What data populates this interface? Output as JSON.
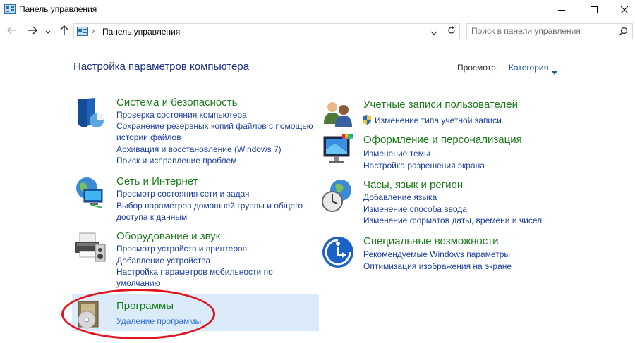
{
  "window": {
    "title": "Панель управления"
  },
  "address": {
    "path": "Панель управления",
    "separator": "›"
  },
  "search": {
    "placeholder": "Поиск в панели управления"
  },
  "header": {
    "heading": "Настройка параметров компьютера",
    "view_label": "Просмотр:",
    "view_value": "Категория"
  },
  "categories": {
    "system": {
      "title": "Система и безопасность",
      "links": [
        "Проверка состояния компьютера",
        "Сохранение резервных копий файлов с помощью",
        "истории файлов",
        "Архивация и восстановление (Windows 7)",
        "Поиск и исправление проблем"
      ]
    },
    "network": {
      "title": "Сеть и Интернет",
      "links": [
        "Просмотр состояния сети и задач",
        "Выбор параметров домашней группы и общего",
        "доступа к данным"
      ]
    },
    "hardware": {
      "title": "Оборудование и звук",
      "links": [
        "Просмотр устройств и принтеров",
        "Добавление устройства",
        "Настройка параметров мобильности по",
        "умолчанию"
      ]
    },
    "programs": {
      "title": "Программы",
      "links": [
        "Удаление программы"
      ]
    },
    "accounts": {
      "title": "Учетные записи пользователей",
      "links": [
        "Изменение типа учетной записи"
      ]
    },
    "appearance": {
      "title": "Оформление и персонализация",
      "links": [
        "Изменение темы",
        "Настройка разрешения экрана"
      ]
    },
    "clock": {
      "title": "Часы, язык и регион",
      "links": [
        "Добавление языка",
        "Изменение способа ввода",
        "Изменение форматов даты, времени и чисел"
      ]
    },
    "ease": {
      "title": "Специальные возможности",
      "links": [
        "Рекомендуемые Windows параметры",
        "Оптимизация изображения на экране"
      ]
    }
  },
  "colors": {
    "category_title": "#1a7a1a",
    "link": "#1e3f9e",
    "heading": "#1e3287",
    "highlight": "#dcebfa",
    "annotation": "#e0141e"
  }
}
